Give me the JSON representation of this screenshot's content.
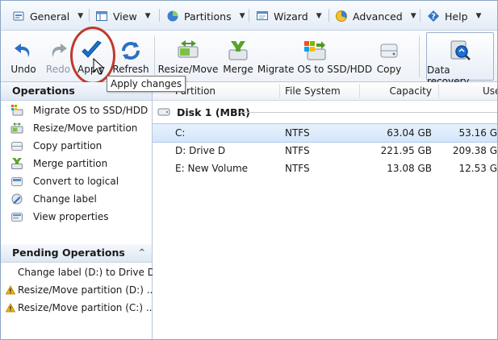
{
  "menu": [
    {
      "label": "General",
      "icon": "wrench-icon"
    },
    {
      "label": "View",
      "icon": "view-icon"
    },
    {
      "label": "Partitions",
      "icon": "partitions-icon"
    },
    {
      "label": "Wizard",
      "icon": "wizard-icon"
    },
    {
      "label": "Advanced",
      "icon": "advanced-icon"
    },
    {
      "label": "Help",
      "icon": "help-icon"
    }
  ],
  "toolbar": {
    "undo": "Undo",
    "redo": "Redo",
    "apply": "Apply",
    "refresh": "Refresh",
    "resize_move": "Resize/Move",
    "merge": "Merge",
    "migrate": "Migrate OS to SSD/HDD",
    "copy": "Copy",
    "data_recovery": "Data recovery",
    "tooltip": "Apply changes"
  },
  "operations": {
    "title": "Operations",
    "items": [
      {
        "label": "Migrate OS to SSD/HDD",
        "icon": "migrate-os-icon"
      },
      {
        "label": "Resize/Move partition",
        "icon": "resize-move-icon"
      },
      {
        "label": "Copy partition",
        "icon": "copy-partition-icon"
      },
      {
        "label": "Merge partition",
        "icon": "merge-partition-icon"
      },
      {
        "label": "Convert to logical",
        "icon": "convert-logical-icon"
      },
      {
        "label": "Change label",
        "icon": "change-label-icon"
      },
      {
        "label": "View properties",
        "icon": "view-properties-icon"
      }
    ]
  },
  "pending": {
    "title": "Pending Operations",
    "items": [
      {
        "label": "Change label (D:) to Drive D",
        "warn": false
      },
      {
        "label": "Resize/Move partition (D:) ...",
        "warn": true
      },
      {
        "label": "Resize/Move partition (C:) ...",
        "warn": true
      }
    ]
  },
  "table": {
    "headers": {
      "partition": "Partition",
      "fs": "File System",
      "capacity": "Capacity",
      "used": "Use"
    },
    "disk": "Disk 1 (MBR)",
    "rows": [
      {
        "partition": "C:",
        "fs": "NTFS",
        "capacity": "63.04 GB",
        "used": "53.16 G",
        "selected": true
      },
      {
        "partition": "D: Drive D",
        "fs": "NTFS",
        "capacity": "221.95 GB",
        "used": "209.38 G",
        "selected": false
      },
      {
        "partition": "E: New Volume",
        "fs": "NTFS",
        "capacity": "13.08 GB",
        "used": "12.53 G",
        "selected": false
      }
    ]
  },
  "colors": {
    "accent": "#1a73c9",
    "highlight_circle": "#c0392b",
    "selection": "#d4e6fa",
    "warning": "#f0b400"
  }
}
